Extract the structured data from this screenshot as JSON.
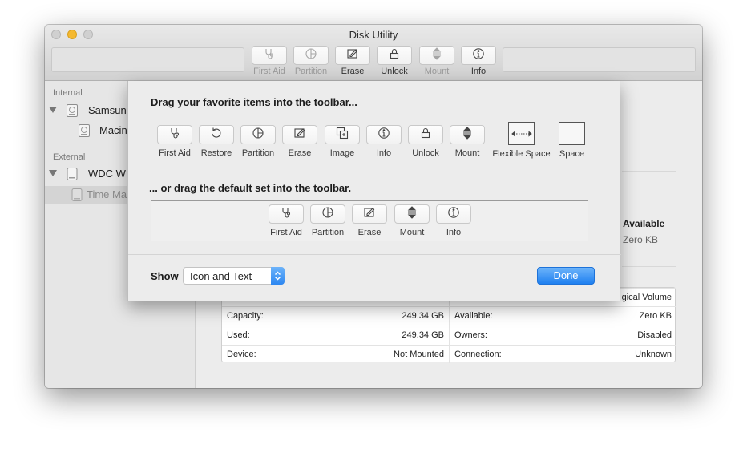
{
  "window": {
    "title": "Disk Utility",
    "toolbar": [
      {
        "label": "First Aid",
        "icon": "stethoscope-icon",
        "enabled": false
      },
      {
        "label": "Partition",
        "icon": "partition-icon",
        "enabled": false
      },
      {
        "label": "Erase",
        "icon": "erase-icon",
        "enabled": true
      },
      {
        "label": "Unlock",
        "icon": "lock-icon",
        "enabled": true
      },
      {
        "label": "Mount",
        "icon": "mount-icon",
        "enabled": false
      },
      {
        "label": "Info",
        "icon": "info-icon",
        "enabled": true
      }
    ]
  },
  "sidebar": {
    "internal_header": "Internal",
    "external_header": "External",
    "items": [
      {
        "label": "Samsung",
        "kind": "disk"
      },
      {
        "label": "Macin",
        "kind": "volume"
      },
      {
        "label": "WDC WI",
        "kind": "disk"
      },
      {
        "label": "Time Ma",
        "kind": "volume"
      }
    ]
  },
  "main": {
    "usage_color": "#f7cc2a",
    "available_header": "Available",
    "available_value": "Zero KB",
    "info_rows": [
      {
        "left_label": "",
        "left_value": "",
        "right_label": "",
        "right_value": "gical Volume"
      },
      {
        "left_label": "Capacity:",
        "left_value": "249.34 GB",
        "right_label": "Available:",
        "right_value": "Zero KB"
      },
      {
        "left_label": "Used:",
        "left_value": "249.34 GB",
        "right_label": "Owners:",
        "right_value": "Disabled"
      },
      {
        "left_label": "Device:",
        "left_value": "Not Mounted",
        "right_label": "Connection:",
        "right_value": "Unknown"
      }
    ]
  },
  "customize_sheet": {
    "palette_title": "Drag your favorite items into the toolbar...",
    "palette_items": [
      {
        "label": "First Aid",
        "icon": "stethoscope-icon"
      },
      {
        "label": "Restore",
        "icon": "restore-icon"
      },
      {
        "label": "Partition",
        "icon": "partition-icon"
      },
      {
        "label": "Erase",
        "icon": "erase-icon"
      },
      {
        "label": "Image",
        "icon": "image-icon"
      },
      {
        "label": "Info",
        "icon": "info-icon"
      },
      {
        "label": "Unlock",
        "icon": "lock-icon"
      },
      {
        "label": "Mount",
        "icon": "mount-icon"
      },
      {
        "label": "Flexible Space",
        "icon": "flexible-space-icon"
      },
      {
        "label": "Space",
        "icon": "space-icon"
      }
    ],
    "default_title": "... or drag the default set into the toolbar.",
    "default_items": [
      {
        "label": "First Aid",
        "icon": "stethoscope-icon"
      },
      {
        "label": "Partition",
        "icon": "partition-icon"
      },
      {
        "label": "Erase",
        "icon": "erase-icon"
      },
      {
        "label": "Mount",
        "icon": "mount-icon"
      },
      {
        "label": "Info",
        "icon": "info-icon"
      }
    ],
    "show_label": "Show",
    "show_value": "Icon and Text",
    "done_label": "Done",
    "accent_color": "#2d87f1"
  }
}
